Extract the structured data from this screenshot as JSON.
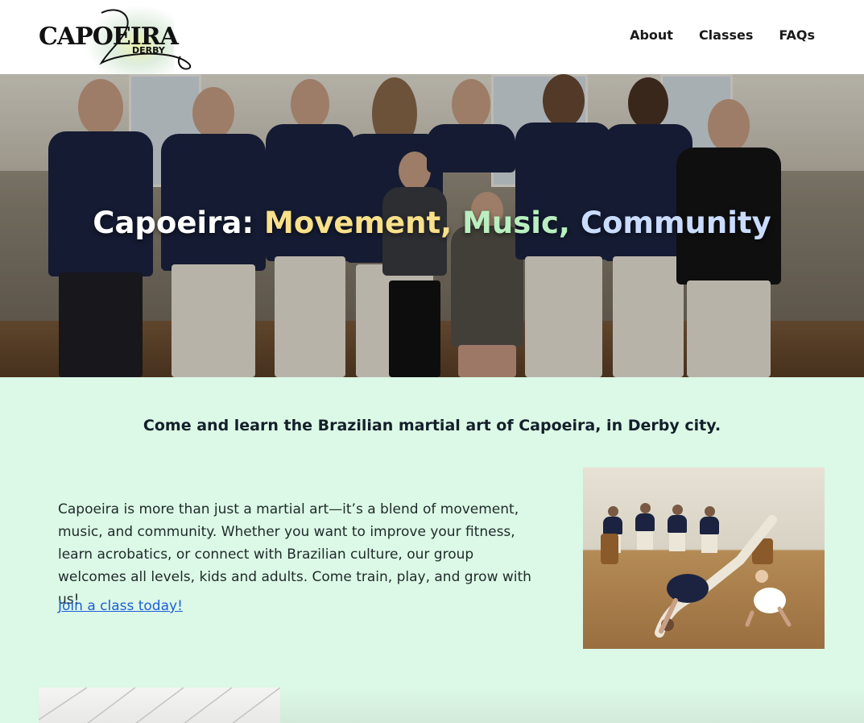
{
  "header": {
    "logo_text": "CAPOEIRA",
    "logo_sub": "DERBY",
    "nav": [
      {
        "label": "About"
      },
      {
        "label": "Classes"
      },
      {
        "label": "FAQs"
      }
    ]
  },
  "hero": {
    "title_part1": "Capoeira:",
    "title_part2": "Movement,",
    "title_part3": "Music,",
    "title_part4": "Community"
  },
  "main": {
    "tagline": "Come and learn the Brazilian martial art of Capoeira, in Derby city.",
    "intro": "Capoeira is more than just a martial art—it’s a blend of movement, music, and community. Whether you want to improve your fitness, learn acrobatics, or connect with Brazilian culture, our group welcomes all levels, kids and adults. Come train, play, and grow with us!",
    "cta_link": "Join a class today!"
  },
  "colors": {
    "page_bg": "#dcf8e6",
    "accent_yellow": "#f9e08a",
    "accent_green": "#b9efc0",
    "accent_blue": "#c9dcff",
    "link": "#1d5fd6"
  }
}
